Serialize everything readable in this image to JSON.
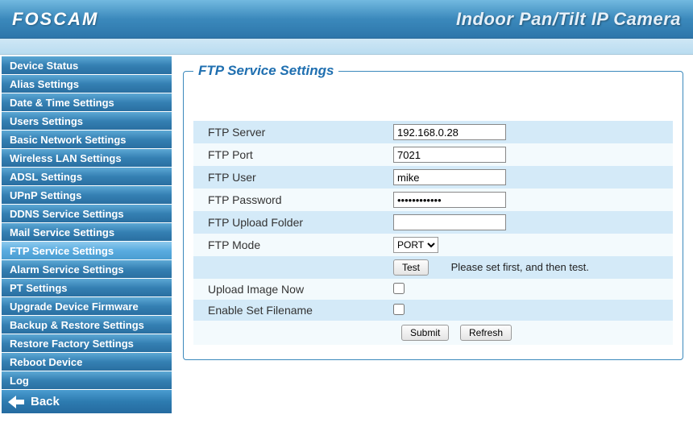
{
  "header": {
    "brand": "FOSCAM",
    "title": "Indoor Pan/Tilt IP Camera"
  },
  "sidebar": {
    "items": [
      {
        "label": "Device Status"
      },
      {
        "label": "Alias Settings"
      },
      {
        "label": "Date & Time Settings"
      },
      {
        "label": "Users Settings"
      },
      {
        "label": "Basic Network Settings"
      },
      {
        "label": "Wireless LAN Settings"
      },
      {
        "label": "ADSL Settings"
      },
      {
        "label": "UPnP Settings"
      },
      {
        "label": "DDNS Service Settings"
      },
      {
        "label": "Mail Service Settings"
      },
      {
        "label": "FTP Service Settings"
      },
      {
        "label": "Alarm Service Settings"
      },
      {
        "label": "PT Settings"
      },
      {
        "label": "Upgrade Device Firmware"
      },
      {
        "label": "Backup & Restore Settings"
      },
      {
        "label": "Restore Factory Settings"
      },
      {
        "label": "Reboot Device"
      },
      {
        "label": "Log"
      }
    ],
    "back": {
      "label": "Back"
    }
  },
  "panel": {
    "title": "FTP Service Settings",
    "fields": {
      "server": {
        "label": "FTP Server",
        "value": "192.168.0.28"
      },
      "port": {
        "label": "FTP Port",
        "value": "7021"
      },
      "user": {
        "label": "FTP User",
        "value": "mike"
      },
      "password": {
        "label": "FTP Password",
        "value": "••••••••••••"
      },
      "upload_folder": {
        "label": "FTP Upload Folder",
        "value": ""
      },
      "mode": {
        "label": "FTP Mode",
        "value": "PORT"
      },
      "test": {
        "button": "Test",
        "message": "Please set first, and then test."
      },
      "upload_now": {
        "label": "Upload Image Now"
      },
      "enable_filename": {
        "label": "Enable Set Filename"
      }
    },
    "actions": {
      "submit": "Submit",
      "refresh": "Refresh"
    }
  }
}
